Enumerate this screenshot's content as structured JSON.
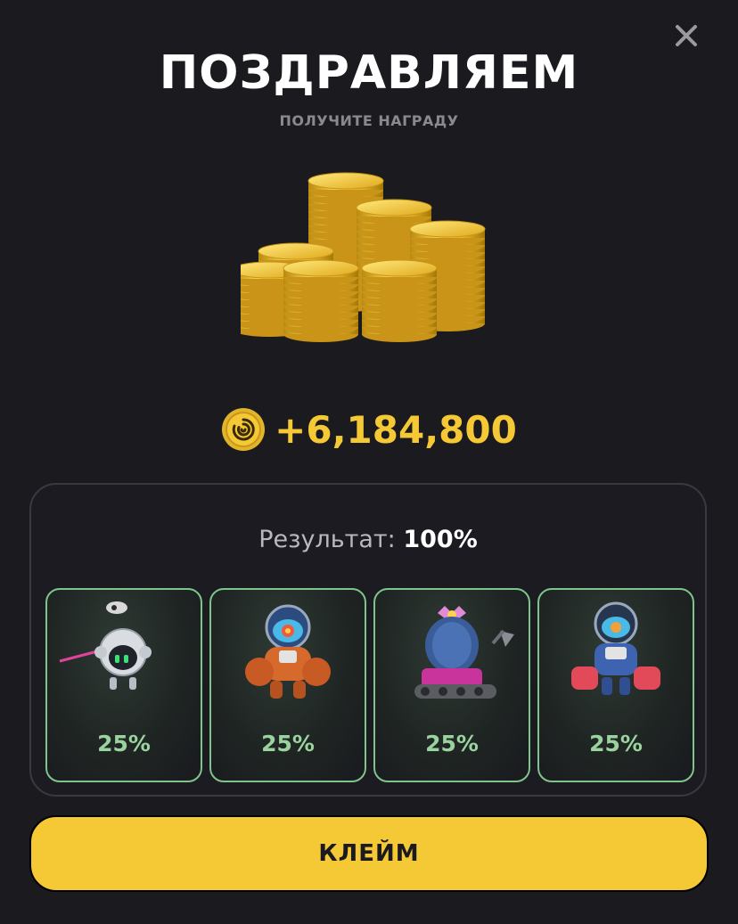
{
  "header": {
    "title": "ПОЗДРАВЛЯЕМ",
    "subtitle": "ПОЛУЧИТЕ НАГРАДУ",
    "close_icon": "close-icon"
  },
  "reward": {
    "amount": "+6,184,800",
    "icon": "coin-icon",
    "color": "#f5c936"
  },
  "result": {
    "label": "Результат:",
    "value": "100%"
  },
  "cards": [
    {
      "name": "drone-robot",
      "percent": "25%"
    },
    {
      "name": "orange-mech-robot",
      "percent": "25%"
    },
    {
      "name": "cactus-tank-robot",
      "percent": "25%"
    },
    {
      "name": "blue-mech-robot",
      "percent": "25%"
    }
  ],
  "claim_button": {
    "label": "КЛЕЙМ",
    "color": "#f5c936"
  }
}
